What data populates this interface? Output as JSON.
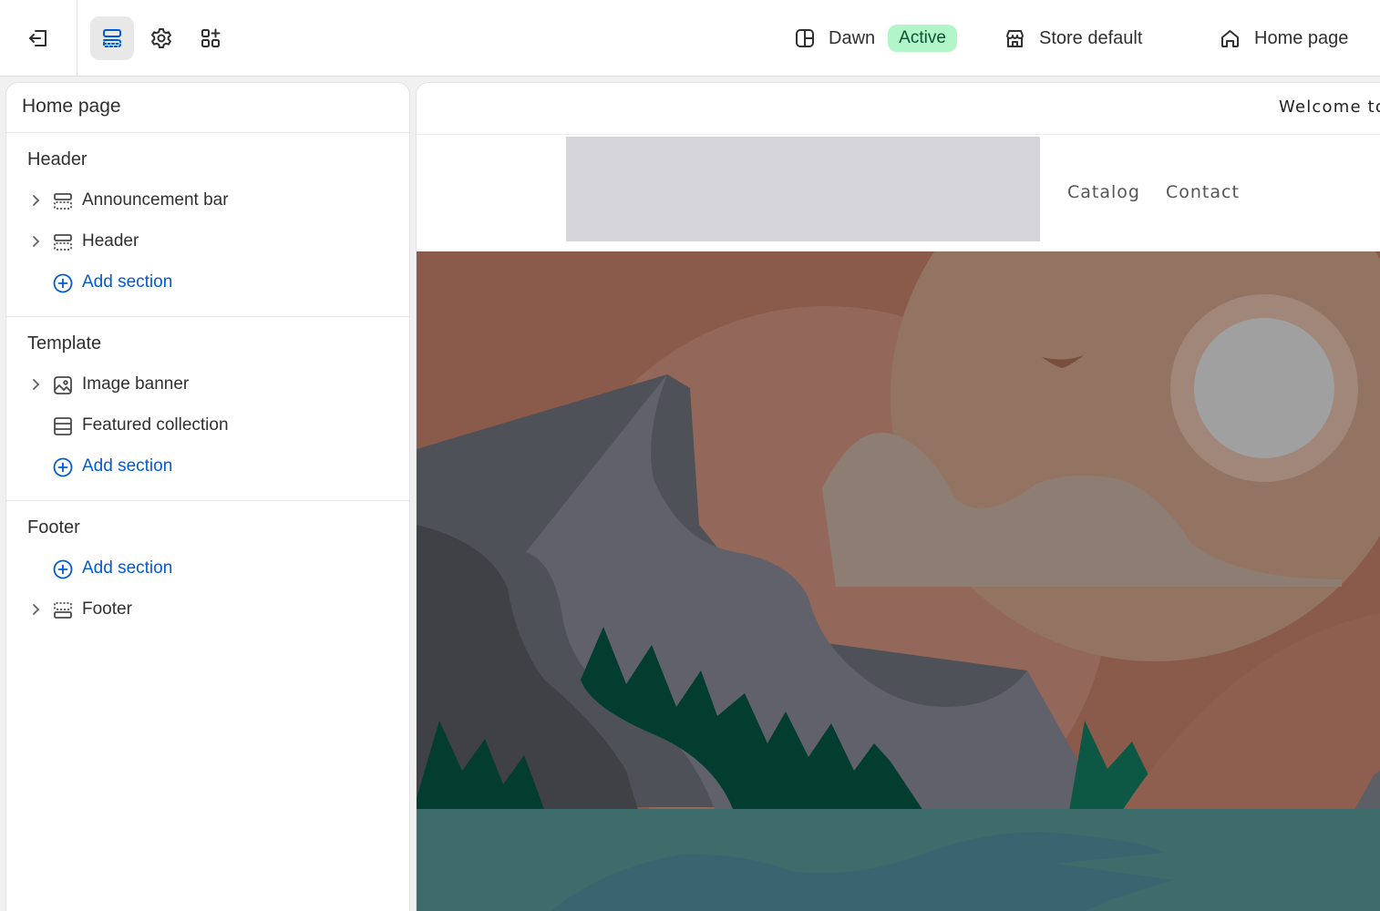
{
  "topbar": {
    "theme_name": "Dawn",
    "theme_status": "Active",
    "market": "Store default",
    "template": "Home page"
  },
  "sidebar": {
    "title": "Home page",
    "groups": [
      {
        "title": "Header",
        "items": [
          {
            "label": "Announcement bar"
          },
          {
            "label": "Header"
          },
          {
            "label": "Add section"
          }
        ]
      },
      {
        "title": "Template",
        "items": [
          {
            "label": "Image banner"
          },
          {
            "label": "Featured collection"
          },
          {
            "label": "Add section"
          }
        ]
      },
      {
        "title": "Footer",
        "items": [
          {
            "label": "Add section"
          },
          {
            "label": "Footer"
          }
        ]
      }
    ]
  },
  "preview": {
    "announcement": "Welcome to",
    "nav": [
      "Catalog",
      "Contact"
    ]
  },
  "colors": {
    "accent": "#005bd3",
    "badge_bg": "#b2f5c8",
    "badge_text": "#0c5132"
  }
}
